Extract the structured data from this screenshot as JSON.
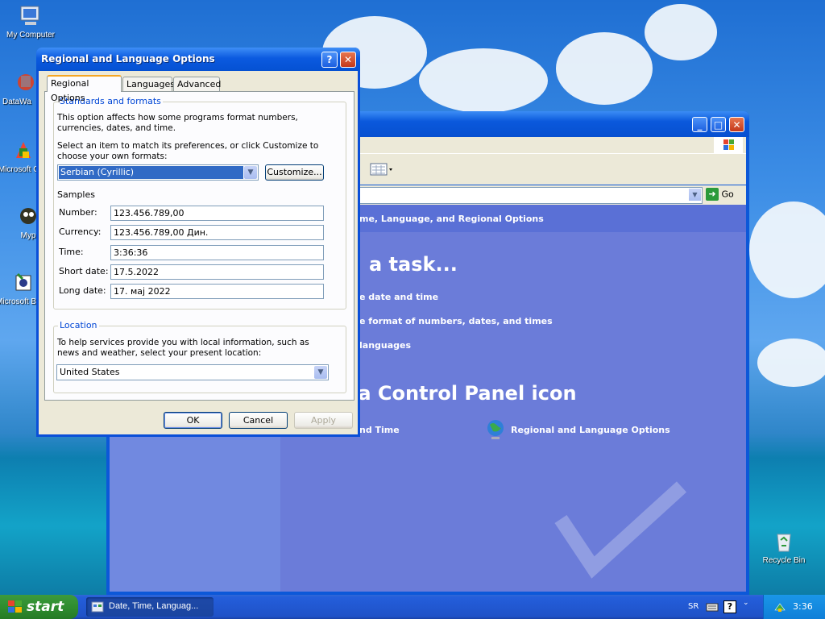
{
  "desktop": {
    "icons": [
      {
        "label": "My Computer"
      },
      {
        "label": "DataWa"
      },
      {
        "label": "Microsoft C++"
      },
      {
        "label": "Myp"
      },
      {
        "label": "Microsoft Basic"
      },
      {
        "label": "Recycle Bin"
      }
    ]
  },
  "control_panel": {
    "address_go": "Go",
    "header": "me, Language, and Regional Options",
    "pick_task": "a task...",
    "tasks": [
      "e date and time",
      "e format of numbers, dates, and times",
      "languages"
    ],
    "or_pick": "k a Control Panel icon",
    "icons": [
      "nd Time",
      "Regional and Language Options"
    ]
  },
  "dialog": {
    "title": "Regional and Language Options",
    "tabs": [
      "Regional Options",
      "Languages",
      "Advanced"
    ],
    "standards": {
      "group_label": "Standards and formats",
      "description": "This option affects how some programs format numbers, currencies, dates, and time.",
      "select_prompt": "Select an item to match its preferences, or click Customize to choose your own formats:",
      "selected_format": "Serbian (Cyrillic)",
      "customize_label": "Customize...",
      "samples_label": "Samples",
      "samples": [
        {
          "label": "Number:",
          "value": "123.456.789,00"
        },
        {
          "label": "Currency:",
          "value": "123.456.789,00 Дин."
        },
        {
          "label": "Time:",
          "value": "3:36:36"
        },
        {
          "label": "Short date:",
          "value": "17.5.2022"
        },
        {
          "label": "Long date:",
          "value": "17. мај 2022"
        }
      ]
    },
    "location": {
      "group_label": "Location",
      "description": "To help services provide you with local information, such as news and weather, select your present location:",
      "selected": "United States"
    },
    "buttons": {
      "ok": "OK",
      "cancel": "Cancel",
      "apply": "Apply"
    }
  },
  "taskbar": {
    "start_label": "start",
    "task_label": "Date, Time, Languag...",
    "language": "SR",
    "clock": "3:36"
  }
}
